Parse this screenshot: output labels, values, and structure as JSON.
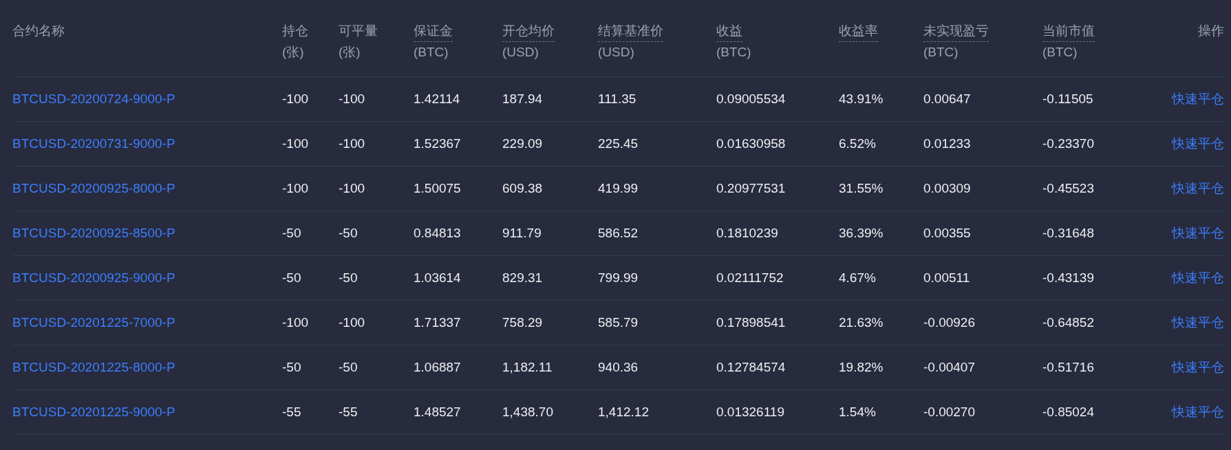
{
  "table": {
    "columns": [
      {
        "label": "合约名称",
        "kind": "link",
        "dashed": false
      },
      {
        "label": "持仓",
        "unit": "(张)",
        "kind": "text",
        "dashed": false
      },
      {
        "label": "可平量",
        "unit": "(张)",
        "kind": "text",
        "dashed": false
      },
      {
        "label": "保证金",
        "unit": "(BTC)",
        "kind": "text",
        "dashed": true
      },
      {
        "label": "开仓均价",
        "unit": "(USD)",
        "kind": "text",
        "dashed": true
      },
      {
        "label": "结算基准价",
        "unit": "(USD)",
        "kind": "text",
        "dashed": true
      },
      {
        "label": "收益",
        "unit": "(BTC)",
        "kind": "text",
        "dashed": true
      },
      {
        "label": "收益率",
        "kind": "text",
        "dashed": true
      },
      {
        "label": "未实现盈亏",
        "unit": "(BTC)",
        "kind": "text",
        "dashed": true
      },
      {
        "label": "当前市值",
        "unit": "(BTC)",
        "kind": "text",
        "dashed": true
      },
      {
        "label": "操作",
        "kind": "action",
        "dashed": false
      }
    ],
    "rows": [
      {
        "cells": [
          "BTCUSD-20200724-9000-P",
          "-100",
          "-100",
          "1.42114",
          "187.94",
          "111.35",
          "0.09005534",
          "43.91%",
          "0.00647",
          "-0.11505",
          "快速平仓"
        ]
      },
      {
        "cells": [
          "BTCUSD-20200731-9000-P",
          "-100",
          "-100",
          "1.52367",
          "229.09",
          "225.45",
          "0.01630958",
          "6.52%",
          "0.01233",
          "-0.23370",
          "快速平仓"
        ]
      },
      {
        "cells": [
          "BTCUSD-20200925-8000-P",
          "-100",
          "-100",
          "1.50075",
          "609.38",
          "419.99",
          "0.20977531",
          "31.55%",
          "0.00309",
          "-0.45523",
          "快速平仓"
        ]
      },
      {
        "cells": [
          "BTCUSD-20200925-8500-P",
          "-50",
          "-50",
          "0.84813",
          "911.79",
          "586.52",
          "0.1810239",
          "36.39%",
          "0.00355",
          "-0.31648",
          "快速平仓"
        ]
      },
      {
        "cells": [
          "BTCUSD-20200925-9000-P",
          "-50",
          "-50",
          "1.03614",
          "829.31",
          "799.99",
          "0.02111752",
          "4.67%",
          "0.00511",
          "-0.43139",
          "快速平仓"
        ]
      },
      {
        "cells": [
          "BTCUSD-20201225-7000-P",
          "-100",
          "-100",
          "1.71337",
          "758.29",
          "585.79",
          "0.17898541",
          "21.63%",
          "-0.00926",
          "-0.64852",
          "快速平仓"
        ]
      },
      {
        "cells": [
          "BTCUSD-20201225-8000-P",
          "-50",
          "-50",
          "1.06887",
          "1,182.11",
          "940.36",
          "0.12784574",
          "19.82%",
          "-0.00407",
          "-0.51716",
          "快速平仓"
        ]
      },
      {
        "cells": [
          "BTCUSD-20201225-9000-P",
          "-55",
          "-55",
          "1.48527",
          "1,438.70",
          "1,412.12",
          "0.01326119",
          "1.54%",
          "-0.00270",
          "-0.85024",
          "快速平仓"
        ]
      }
    ]
  }
}
